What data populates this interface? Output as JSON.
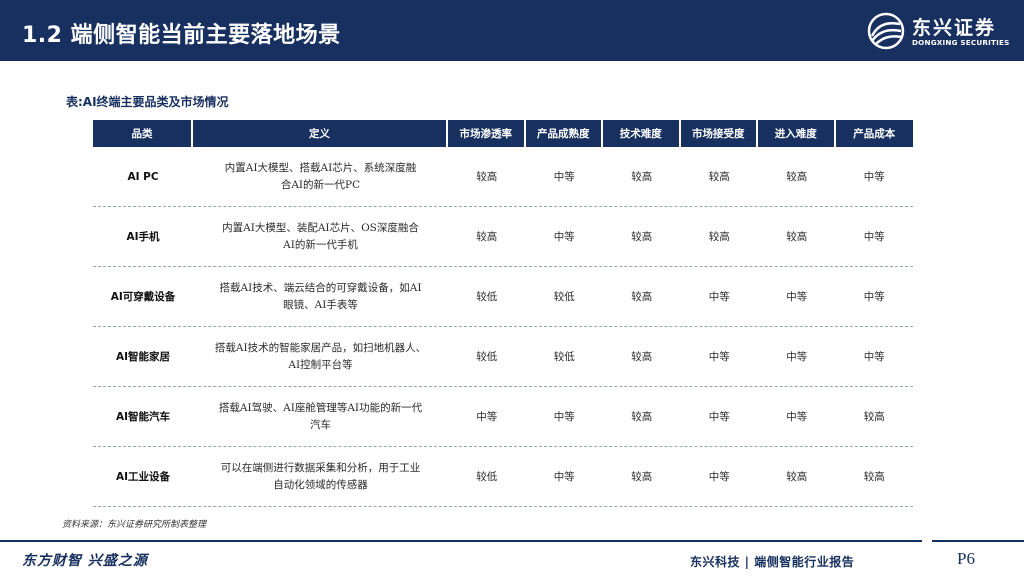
{
  "header": {
    "title": "1.2 端侧智能当前主要落地场景",
    "logo_cn": "东兴证券",
    "logo_en": "DONGXING SECURITIES"
  },
  "caption": "表:AI终端主要品类及市场情况",
  "table": {
    "headers": [
      "品类",
      "定义",
      "市场渗透率",
      "产品成熟度",
      "技术难度",
      "市场接受度",
      "进入难度",
      "产品成本"
    ],
    "rows": [
      {
        "name": "AI PC",
        "def1": "内置AI大模型、搭载AI芯片、系统深度融",
        "def2": "合AI的新一代PC",
        "v": [
          "较高",
          "中等",
          "较高",
          "较高",
          "较高",
          "中等"
        ]
      },
      {
        "name": "AI手机",
        "def1": "内置AI大模型、装配AI芯片、OS深度融合",
        "def2": "AI的新一代手机",
        "v": [
          "较高",
          "中等",
          "较高",
          "较高",
          "较高",
          "中等"
        ]
      },
      {
        "name": "AI可穿戴设备",
        "def1": "搭载AI技术、端云结合的可穿戴设备，如AI",
        "def2": "眼镜、AI手表等",
        "v": [
          "较低",
          "较低",
          "较高",
          "中等",
          "中等",
          "中等"
        ]
      },
      {
        "name": "AI智能家居",
        "def1": "搭载AI技术的智能家居产品，如扫地机器人、",
        "def2": "AI控制平台等",
        "v": [
          "较低",
          "较低",
          "较高",
          "中等",
          "中等",
          "中等"
        ]
      },
      {
        "name": "AI智能汽车",
        "def1": "搭载AI驾驶、AI座舱管理等AI功能的新一代",
        "def2": "汽车",
        "v": [
          "中等",
          "中等",
          "较高",
          "中等",
          "中等",
          "较高"
        ]
      },
      {
        "name": "AI工业设备",
        "def1": "可以在端侧进行数据采集和分析，用于工业",
        "def2": "自动化领域的传感器",
        "v": [
          "较低",
          "中等",
          "较高",
          "中等",
          "较高",
          "较高"
        ]
      }
    ]
  },
  "source": "资料来源：东兴证券研究所制表整理",
  "footer": {
    "slogan": "东方财智  兴盛之源",
    "report": "东兴科技 | 端侧智能行业报告",
    "page": "P6"
  },
  "colors": {
    "brand": "#17305f"
  }
}
